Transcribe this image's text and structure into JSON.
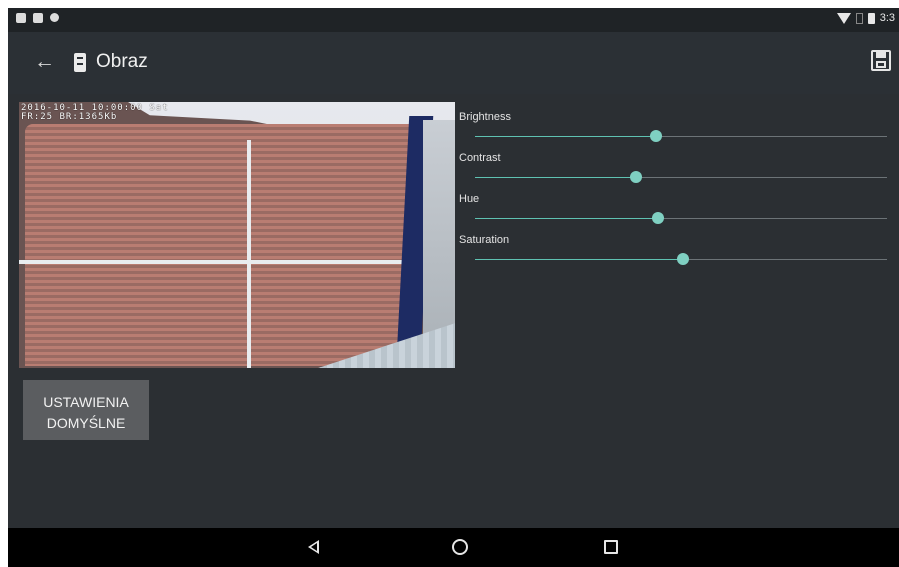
{
  "status_bar": {
    "time": "3:3",
    "icons": [
      "notification-icon-1",
      "notification-icon-2",
      "notification-icon-3",
      "wifi-icon",
      "signal-icon",
      "battery-icon"
    ]
  },
  "app_bar": {
    "title": "Obraz",
    "back_icon": "arrow-left-icon",
    "title_icon": "device-icon",
    "save_icon": "save-icon"
  },
  "camera": {
    "osd_line1": "2016-10-11 10:00:00 Sat",
    "osd_line2": "FR:25 BR:1365Kb"
  },
  "sliders": [
    {
      "label": "Brightness",
      "value": 0.44
    },
    {
      "label": "Contrast",
      "value": 0.39
    },
    {
      "label": "Hue",
      "value": 0.445
    },
    {
      "label": "Saturation",
      "value": 0.505
    }
  ],
  "reset_button": {
    "label": "USTAWIENIA\nDOMYŚLNE"
  },
  "nav_bar": {
    "back_icon": "triangle-back-icon",
    "home_icon": "circle-home-icon",
    "recents_icon": "square-recents-icon"
  },
  "colors": {
    "accent": "#7fd0c2",
    "background": "#2b2f33",
    "appbar": "#2b3035"
  }
}
